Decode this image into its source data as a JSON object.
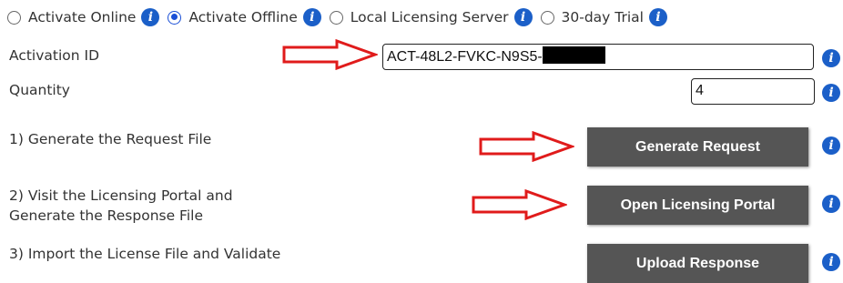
{
  "activation_modes": [
    {
      "label": "Activate Online",
      "selected": false
    },
    {
      "label": "Activate Offline",
      "selected": true
    },
    {
      "label": "Local Licensing Server",
      "selected": false
    },
    {
      "label": "30-day Trial",
      "selected": false
    }
  ],
  "activation_id": {
    "label": "Activation ID",
    "value": "ACT-48L2-FVKC-N9S5-"
  },
  "quantity": {
    "label": "Quantity",
    "value": "4"
  },
  "steps": [
    {
      "text": "1) Generate the Request File",
      "button": "Generate Request"
    },
    {
      "text": "2) Visit the Licensing Portal and\nGenerate the Response File",
      "button": "Open Licensing Portal"
    },
    {
      "text": "3) Import the License File and Validate",
      "button": "Upload Response"
    }
  ],
  "info_glyph": "i",
  "colors": {
    "button_bg": "#555555",
    "info_icon": "#1b5fc8",
    "radio_selected": "#1a4fd6",
    "arrow": "#e01b1b"
  },
  "annotations": {
    "arrows": 3,
    "arrow_icon": "red-outline-right-arrow"
  }
}
